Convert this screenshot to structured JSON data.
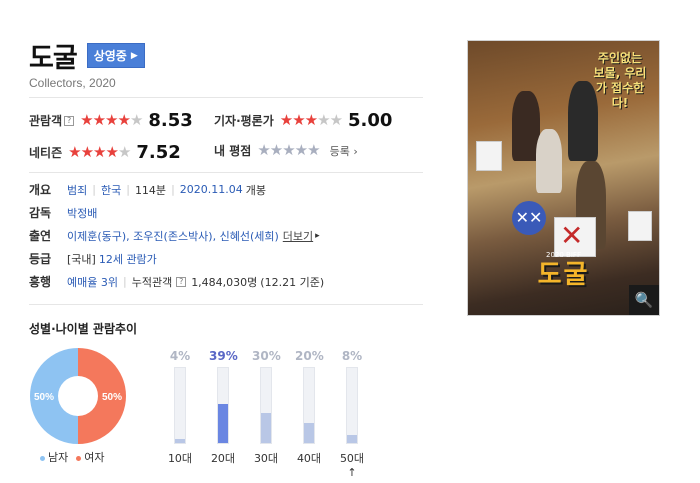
{
  "movie": {
    "title": "도굴",
    "status": "상영중",
    "original_title": "Collectors, 2020"
  },
  "ratings": {
    "audience": {
      "label": "관람객",
      "score": "8.53",
      "stars": 4.25
    },
    "critics": {
      "label": "기자·평론가",
      "score": "5.00",
      "stars": 2.5
    },
    "netizen": {
      "label": "네티즌",
      "score": "7.52",
      "stars": 3.75
    },
    "my": {
      "label": "내 평점",
      "action": "등록"
    }
  },
  "info": {
    "overview": {
      "label": "개요",
      "genre": "범죄",
      "country": "한국",
      "runtime": "114분",
      "release": "2020.11.04",
      "release_suffix": "개봉"
    },
    "director": {
      "label": "감독",
      "name": "박정배"
    },
    "cast": {
      "label": "출연",
      "actors": "이제훈(동구), 조우진(존스박사), 신혜선(세희)",
      "more": "더보기"
    },
    "grade": {
      "label": "등급",
      "prefix": "[국내]",
      "value": "12세 관람가"
    },
    "boxoffice": {
      "label": "흥행",
      "rank": "예매율 3위",
      "cumulative_label": "누적관객",
      "cumulative": "1,484,030명",
      "as_of": "(12.21 기준)"
    }
  },
  "demographics": {
    "title": "성별·나이별 관람추이",
    "gender": {
      "male_pct": "50%",
      "female_pct": "50%",
      "male_label": "남자",
      "female_label": "여자",
      "male_color": "#8ec3f2",
      "female_color": "#f4785c"
    },
    "age_bars": [
      {
        "age": "10대",
        "pct": "4%",
        "value": 4
      },
      {
        "age": "20대",
        "pct": "39%",
        "value": 39,
        "highlight": true
      },
      {
        "age": "30대",
        "pct": "30%",
        "value": 30
      },
      {
        "age": "40대",
        "pct": "20%",
        "value": 20
      },
      {
        "age": "50대↑",
        "pct": "8%",
        "value": 8
      }
    ]
  },
  "poster": {
    "tagline": "주인없는 보물, 우리가 접수한다!",
    "logo": "도굴",
    "festival": "2020 BIFF"
  },
  "icons": {
    "badge_arrow": "chevron-right-icon",
    "help": "question-icon",
    "zoom": "search-icon"
  }
}
